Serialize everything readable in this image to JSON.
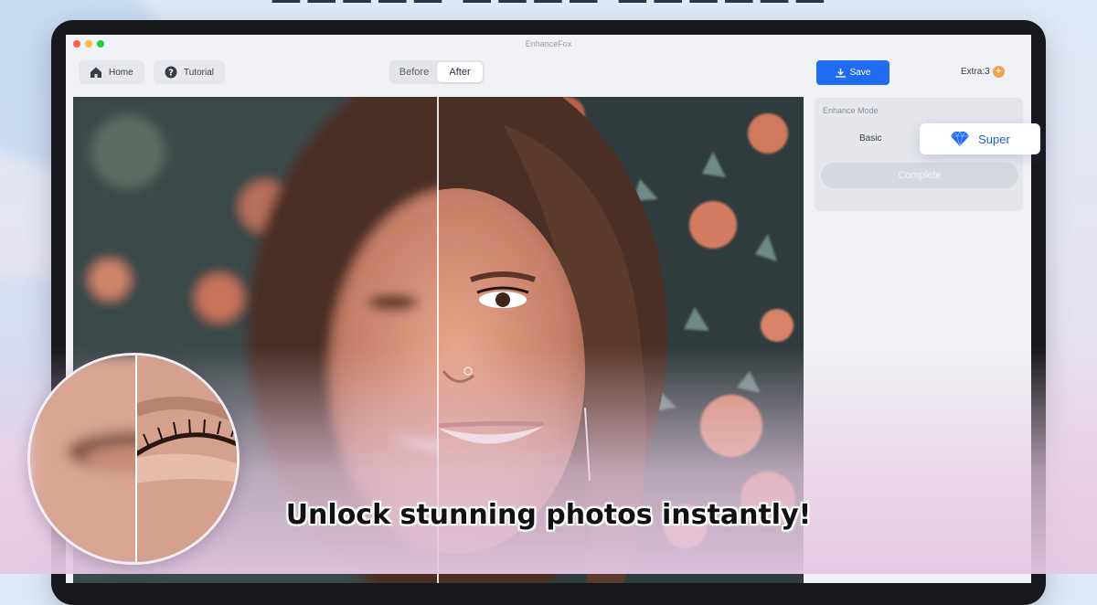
{
  "promo": {
    "tagline": "Unlock stunning photos instantly!"
  },
  "app": {
    "title": "EnhanceFox"
  },
  "toolbar": {
    "home_label": "Home",
    "home_icon": "home-icon",
    "tutorial_label": "Tutorial",
    "tutorial_icon": "question-icon",
    "view_toggle": {
      "before_label": "Before",
      "after_label": "After",
      "active": "After"
    },
    "save_label": "Save",
    "save_icon": "download-icon",
    "extra_label": "Extra:3",
    "extra_icon": "plus-coin-icon"
  },
  "enhance_panel": {
    "title": "Enhance Mode",
    "basic_label": "Basic",
    "super_label": "Super",
    "super_icon": "diamond-icon",
    "selected_mode": "Super",
    "complete_label": "Complete"
  },
  "colors": {
    "accent": "#1f6bf2",
    "coin": "#f5a04a",
    "super_text": "#1f5fd8"
  }
}
